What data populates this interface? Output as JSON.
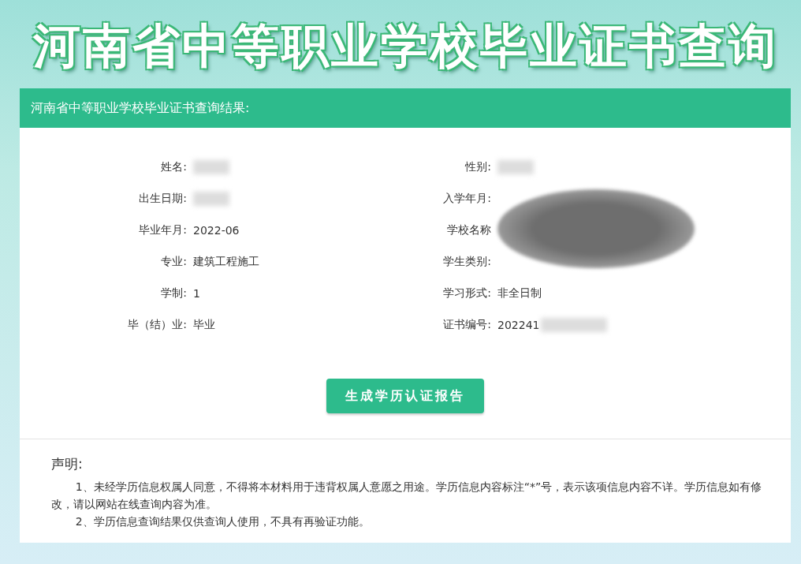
{
  "page_title": "河南省中等职业学校毕业证书查询",
  "result_panel": {
    "header": "河南省中等职业学校毕业证书查询结果:",
    "left_fields": [
      {
        "label": "姓名:",
        "blurred": true
      },
      {
        "label": "出生日期:",
        "blurred": true
      },
      {
        "label": "毕业年月:",
        "value": "2022-06"
      },
      {
        "label": "专业:",
        "value": "建筑工程施工"
      },
      {
        "label": "学制:",
        "value": "1"
      },
      {
        "label": "毕（结）业:",
        "value": "毕业"
      }
    ],
    "right_fields": [
      {
        "label": "性别:",
        "blurred": true
      },
      {
        "label": "入学年月:"
      },
      {
        "label": "学校名称"
      },
      {
        "label": "学生类别:"
      },
      {
        "label": "学习形式:",
        "value": "非全日制"
      },
      {
        "label": "证书编号:",
        "value": "202241",
        "blurred": true
      }
    ],
    "scribble_overlay": true,
    "report_button": "生成学历认证报告"
  },
  "statement": {
    "title": "声明:",
    "paragraphs": [
      "1、未经学历信息权属人同意，不得将本材料用于违背权属人意愿之用途。学历信息内容标注“*”号，表示该项信息内容不详。学历信息如有修改，请以网站在线查询内容为准。",
      "2、学历信息查询结果仅供查询人使用，不具有再验证功能。"
    ]
  }
}
